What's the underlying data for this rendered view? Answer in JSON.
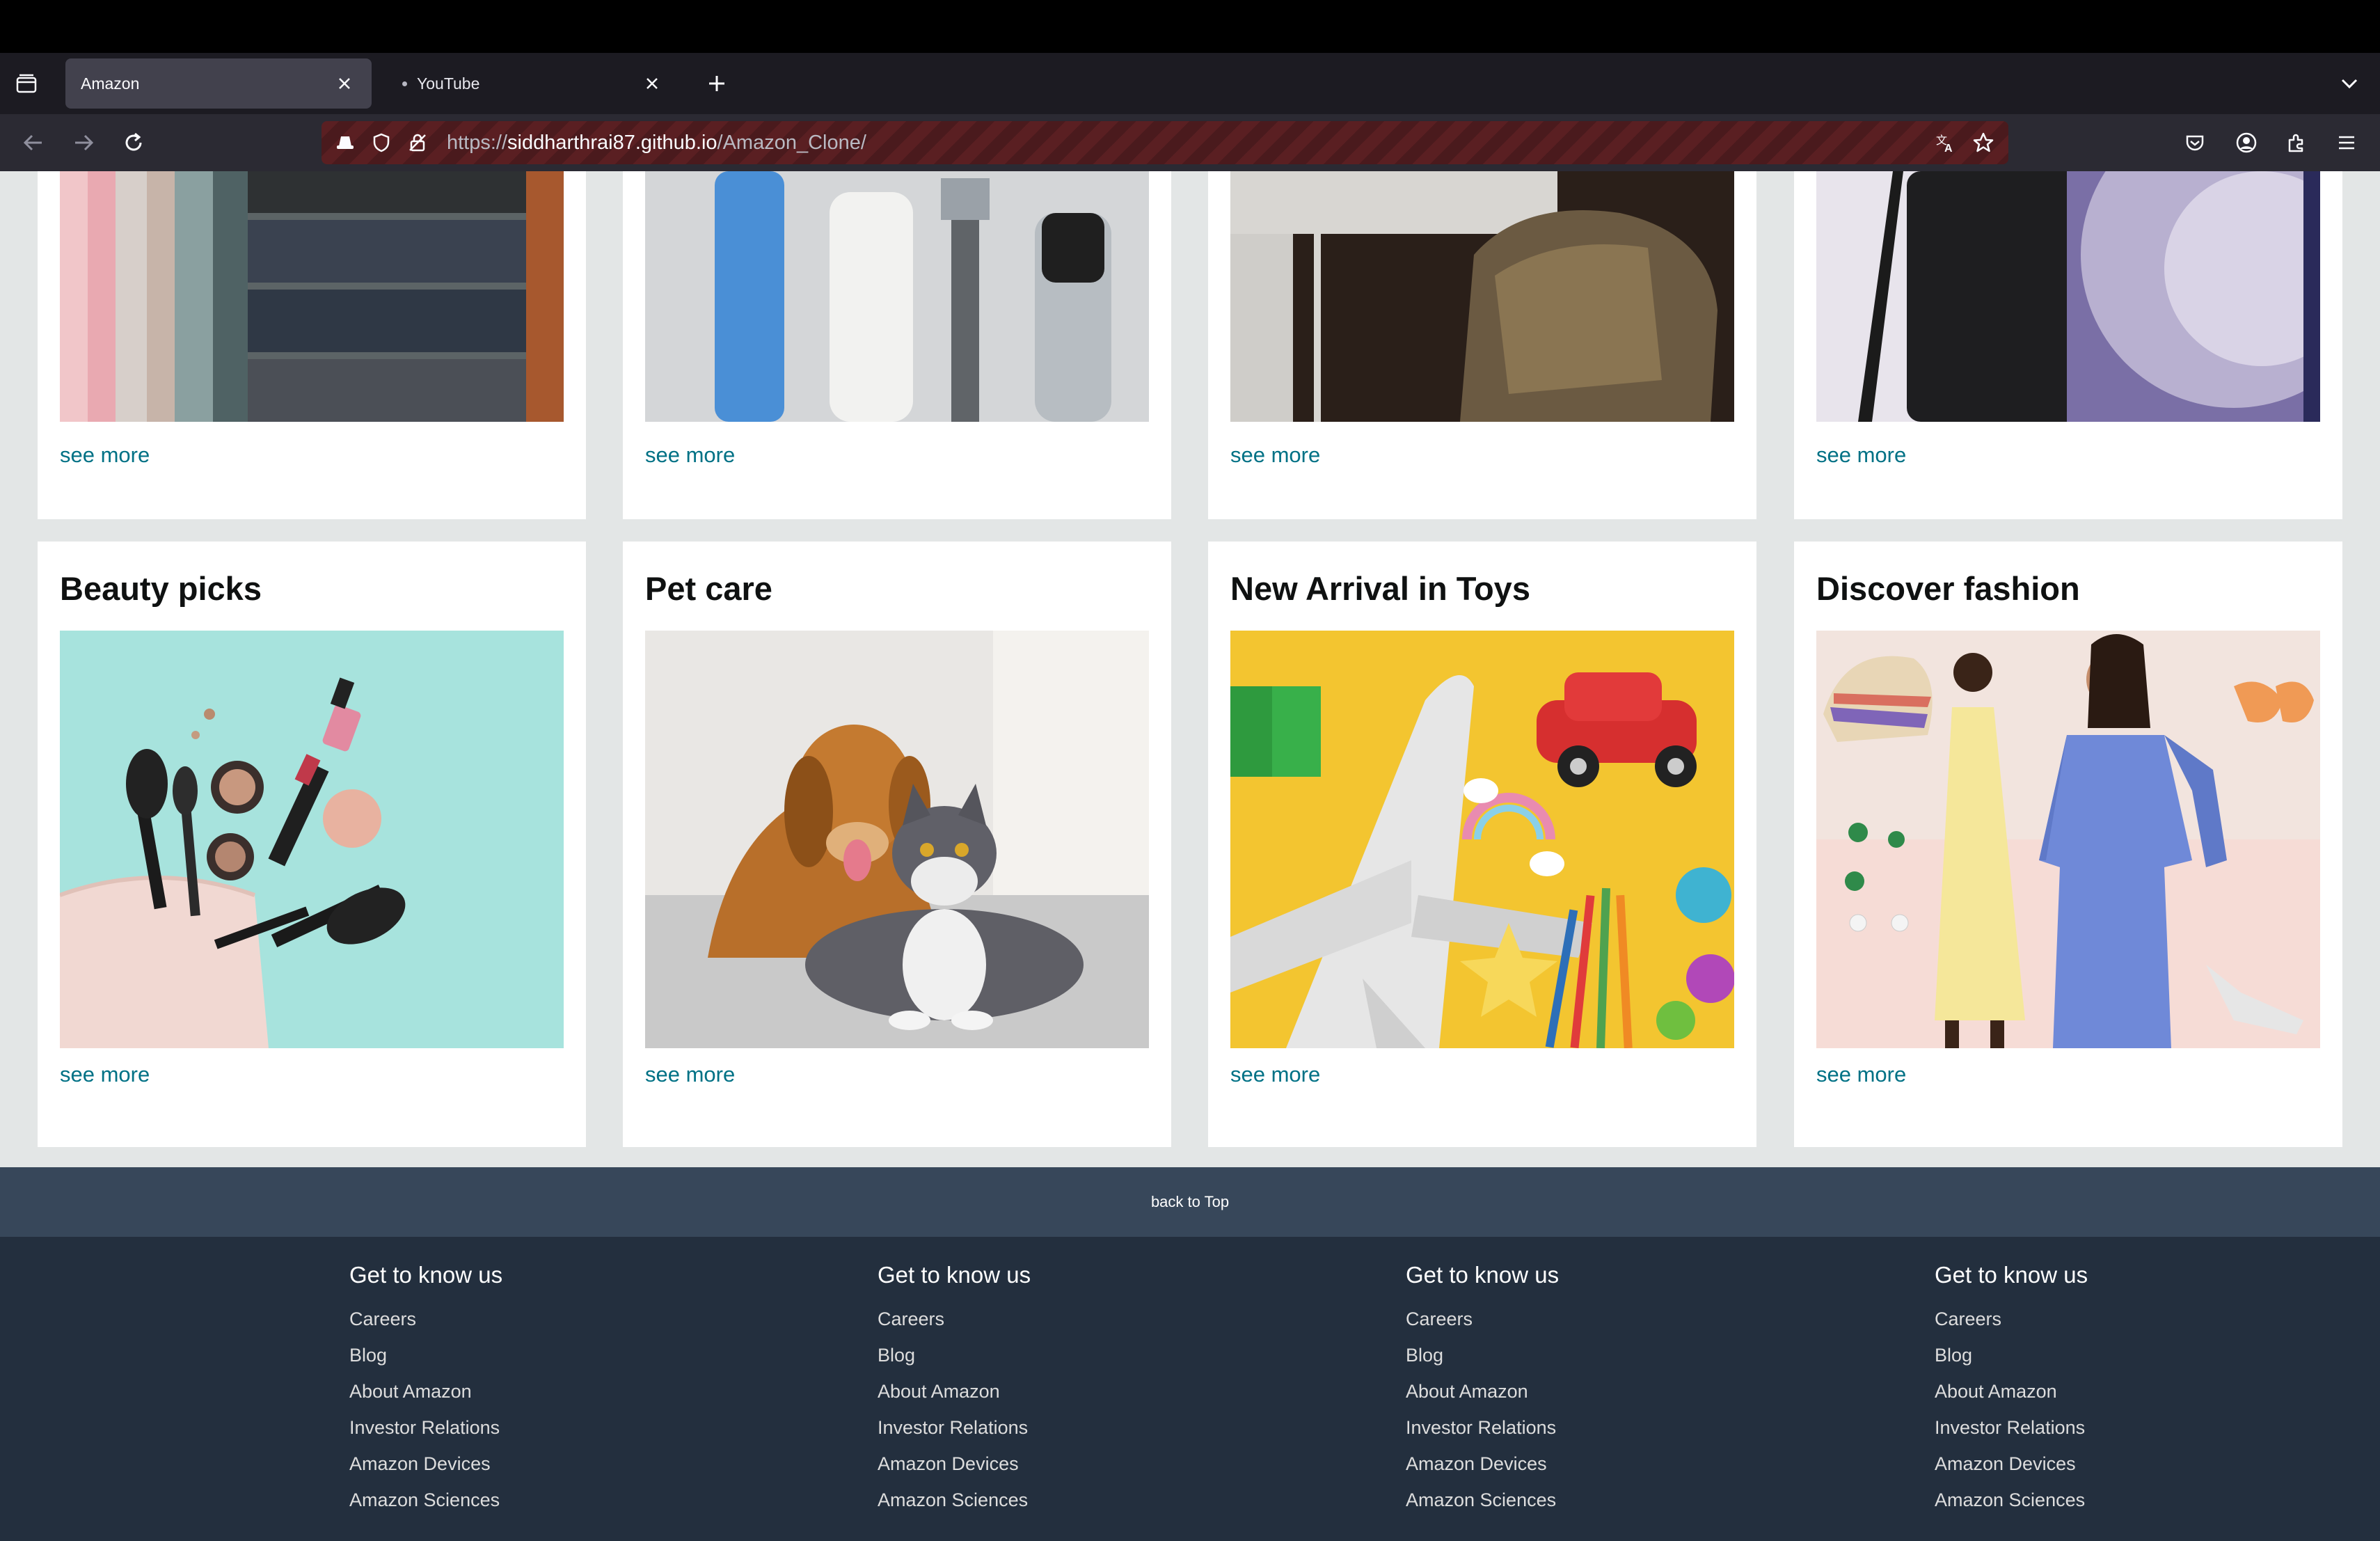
{
  "browser": {
    "tabs": [
      {
        "title": "Amazon",
        "active": true
      },
      {
        "title": "YouTube",
        "active": false
      }
    ],
    "url": {
      "scheme": "https://",
      "host": "siddharthrai87.github.io",
      "path": "/Amazon_Clone/"
    },
    "icons": {
      "tab_list": "tab-list-icon",
      "new_tab": "plus-icon",
      "overflow": "chevron-down-icon",
      "back": "arrow-left-icon",
      "forward": "arrow-right-icon",
      "reload": "reload-icon",
      "translate": "translate-icon",
      "bookmark": "star-icon",
      "pocket": "pocket-icon",
      "account": "account-icon",
      "extensions": "puzzle-icon",
      "menu": "hamburger-menu-icon"
    }
  },
  "top_cards": [
    {
      "image": "fabric swatches",
      "link": "see more"
    },
    {
      "image": "personal care products",
      "link": "see more"
    },
    {
      "image": "desk and chair",
      "link": "see more"
    },
    {
      "image": "smartphone with stylus",
      "link": "see more"
    }
  ],
  "cards": [
    {
      "title": "Beauty picks",
      "image": "makeup brushes and cosmetics",
      "link": "see more"
    },
    {
      "title": "Pet care",
      "image": "dog and cat",
      "link": "see more"
    },
    {
      "title": "New Arrival in Toys",
      "image": "toy airplane, car and pencils",
      "link": "see more"
    },
    {
      "title": "Discover fashion",
      "image": "women in summer dresses",
      "link": "see more"
    }
  ],
  "back_to_top": "back to Top",
  "footer": {
    "columns": [
      {
        "heading": "Get to know us",
        "links": [
          "Careers",
          "Blog",
          "About Amazon",
          "Investor Relations",
          "Amazon Devices",
          "Amazon Sciences"
        ]
      },
      {
        "heading": "Get to know us",
        "links": [
          "Careers",
          "Blog",
          "About Amazon",
          "Investor Relations",
          "Amazon Devices",
          "Amazon Sciences"
        ]
      },
      {
        "heading": "Get to know us",
        "links": [
          "Careers",
          "Blog",
          "About Amazon",
          "Investor Relations",
          "Amazon Devices",
          "Amazon Sciences"
        ]
      },
      {
        "heading": "Get to know us",
        "links": [
          "Careers",
          "Blog",
          "About Amazon",
          "Investor Relations",
          "Amazon Devices",
          "Amazon Sciences"
        ]
      }
    ]
  },
  "colors": {
    "link": "#007185",
    "back_to_top_bg": "#37475a",
    "footer_bg": "#232f3e",
    "page_bg": "#e3e6e6"
  }
}
